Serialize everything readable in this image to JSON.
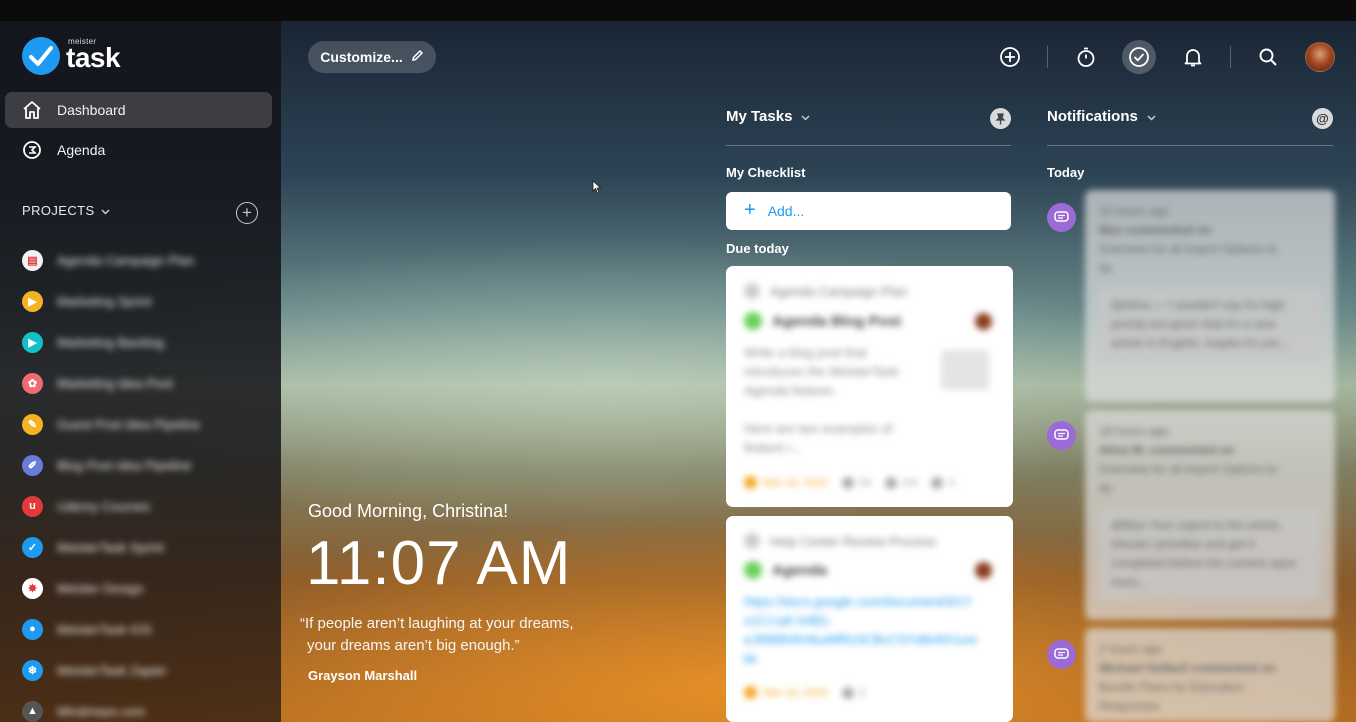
{
  "app": {
    "logo_small": "meister",
    "logo_big": "task"
  },
  "sidebar": {
    "nav": [
      {
        "label": "Dashboard",
        "icon": "home-icon",
        "active": true
      },
      {
        "label": "Agenda",
        "icon": "agenda-icon",
        "active": false
      }
    ],
    "projects_header": "PROJECTS",
    "projects": [
      {
        "label": "Agenda Campaign Plan",
        "icon": "calendar-icon",
        "color": "#f2f2f2"
      },
      {
        "label": "Marketing Sprint",
        "icon": "megaphone-icon",
        "color": "#f5b324"
      },
      {
        "label": "Marketing Backlog",
        "icon": "megaphone-icon",
        "color": "#16c0c8"
      },
      {
        "label": "Marketing Idea Pool",
        "icon": "brain-icon",
        "color": "#ef6b73"
      },
      {
        "label": "Guest Post Idea Pipeline",
        "icon": "pencil-icon",
        "color": "#f5b324"
      },
      {
        "label": "Blog Post Idea Pipeline",
        "icon": "brush-icon",
        "color": "#6a7bd8"
      },
      {
        "label": "Udemy Courses",
        "icon": "udemy-icon",
        "color": "#e23a3a"
      },
      {
        "label": "MeisterTask Sprint",
        "icon": "check-icon",
        "color": "#1e9bf0"
      },
      {
        "label": "Meister Design",
        "icon": "palette-icon",
        "color": "#ffffff"
      },
      {
        "label": "MeisterTask iOS",
        "icon": "apple-icon",
        "color": "#1e9bf0"
      },
      {
        "label": "MeisterTask Zapier",
        "icon": "snowflake-icon",
        "color": "#1e9bf0"
      },
      {
        "label": "Mindmeps.com",
        "icon": "rocket-icon",
        "color": "#555555"
      }
    ]
  },
  "header": {
    "customize_label": "Customize...",
    "icons": [
      "add-icon",
      "timer-icon",
      "tasks-check-icon",
      "bell-icon",
      "search-icon"
    ]
  },
  "welcome": {
    "greeting": "Good Morning, Christina!",
    "time": "11:07 AM",
    "quote_line1": "“If people aren’t laughing at your dreams,",
    "quote_line2": "your dreams aren’t big enough.”",
    "author": "Grayson Marshall"
  },
  "my_tasks": {
    "title": "My Tasks",
    "checklist_label": "My Checklist",
    "add_placeholder": "Add...",
    "due_today_label": "Due today",
    "cards": [
      {
        "project": "Agenda Campaign Plan",
        "name": "Agenda Blog Post",
        "desc_lines": [
          "Write a blog post that",
          "introduces the MeisterTask",
          "Agenda feature.",
          "",
          "Here are two examples of",
          "feature i..."
        ],
        "date": "Mar 16, 2020",
        "count1": "34",
        "count2": "2/4",
        "count3": "4"
      },
      {
        "project": "Help Center Review Process",
        "name": "Agenda",
        "link_lines": [
          "https://docs.google.com/document/d/1Y",
          "x1CJ-p8-S4B1-",
          "eJ8IB8HKHbuMfRz3CBcCSYdIkr8X1xm",
          "kk"
        ],
        "date": "Mar 16, 2020",
        "count1": "3"
      }
    ]
  },
  "notifications": {
    "title": "Notifications",
    "today_label": "Today",
    "items": [
      {
        "time": "15 hours ago",
        "line1": "Max commented on",
        "line2": "Overview for all Import Options to",
        "line3": "do",
        "quote": "@Alina — I wouldn't say it's high priority but given that it's a new article in English, maybe it's pre..."
      },
      {
        "time": "18 hours ago",
        "line1": "Alina W. commented on",
        "line2": "Overview for all Import Options to",
        "line3": "do",
        "quote": "@Max Your urgent to the article, should I prioritise and get it completed before the content upon more..."
      },
      {
        "time": "2 hours ago",
        "line1": "Michael Hollauf commented on",
        "line2": "Bundle Plans for Education",
        "line3": "Responses",
        "quote": ""
      }
    ]
  }
}
